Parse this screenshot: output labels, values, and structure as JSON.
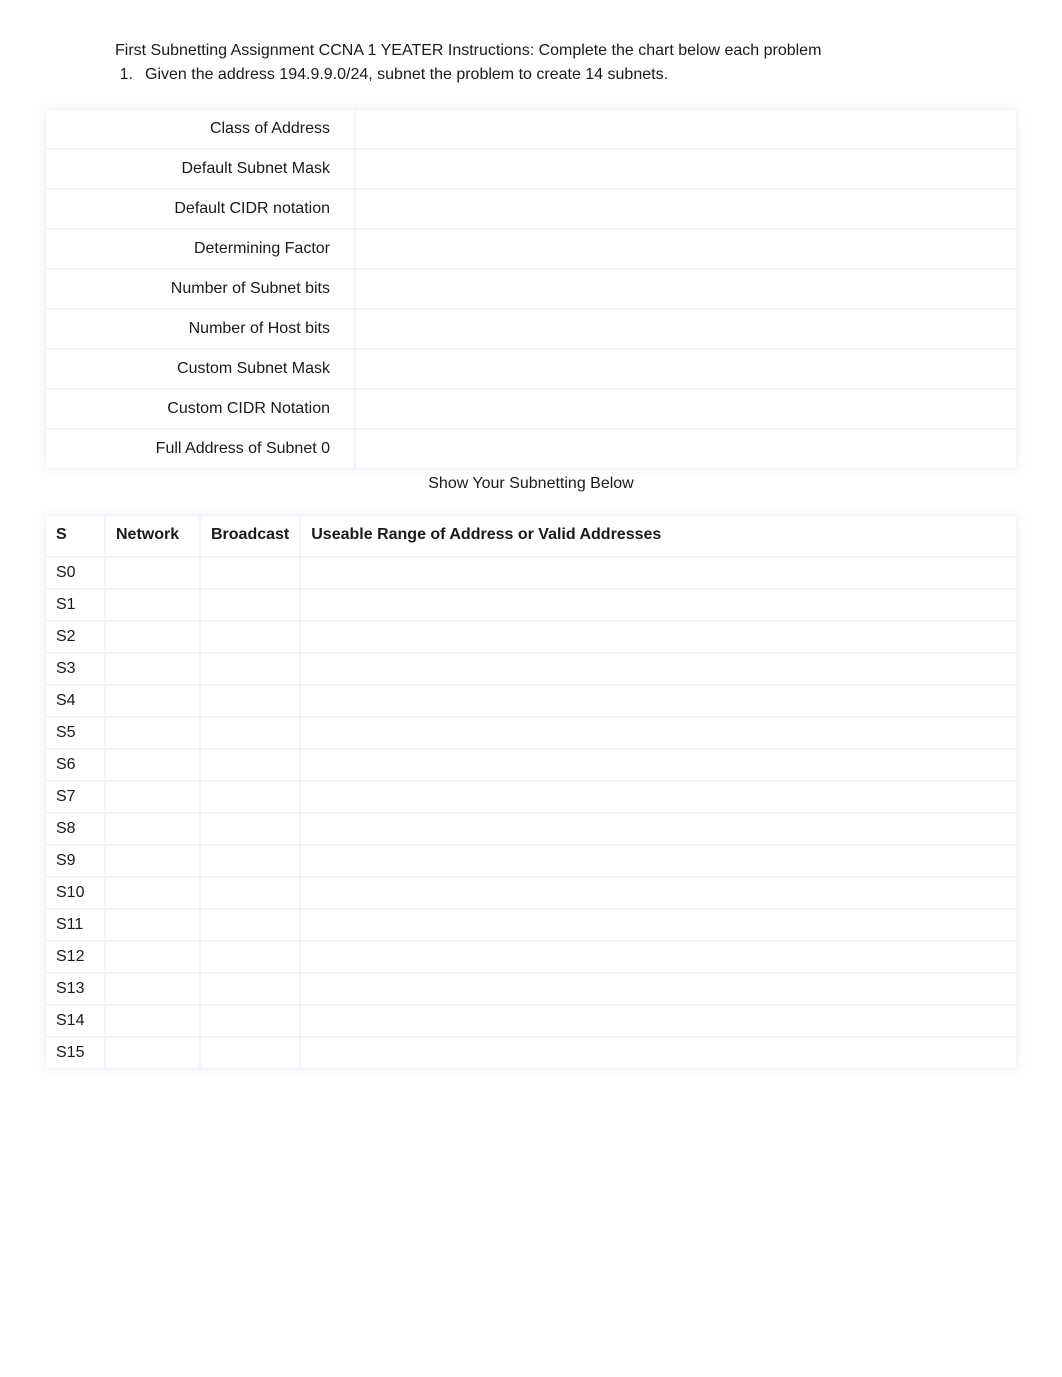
{
  "header": {
    "instructions": "First Subnetting Assignment CCNA 1   YEATER Instructions: Complete the chart below each problem",
    "problem_number": "1.",
    "problem_text": "Given the address 194.9.9.0/24, subnet the problem to create 14 subnets."
  },
  "info_rows": [
    {
      "label": "Class of Address",
      "value": ""
    },
    {
      "label": "Default Subnet Mask",
      "value": ""
    },
    {
      "label": "Default CIDR notation",
      "value": ""
    },
    {
      "label": "Determining Factor",
      "value": ""
    },
    {
      "label": "Number of Subnet bits",
      "value": ""
    },
    {
      "label": "Number of Host bits",
      "value": ""
    },
    {
      "label": "Custom Subnet Mask",
      "value": ""
    },
    {
      "label": "Custom CIDR Notation",
      "value": ""
    },
    {
      "label": "Full Address of Subnet 0",
      "value": ""
    }
  ],
  "subnetting_caption": "Show Your Subnetting Below",
  "subnet_headers": {
    "s": "S",
    "network": "Network",
    "broadcast": "Broadcast",
    "range": "Useable Range of Address or Valid Addresses"
  },
  "subnet_rows": [
    {
      "s": "S0",
      "network": "",
      "broadcast": "",
      "range": ""
    },
    {
      "s": "S1",
      "network": "",
      "broadcast": "",
      "range": ""
    },
    {
      "s": "S2",
      "network": "",
      "broadcast": "",
      "range": ""
    },
    {
      "s": "S3",
      "network": "",
      "broadcast": "",
      "range": ""
    },
    {
      "s": "S4",
      "network": "",
      "broadcast": "",
      "range": ""
    },
    {
      "s": "S5",
      "network": "",
      "broadcast": "",
      "range": ""
    },
    {
      "s": "S6",
      "network": "",
      "broadcast": "",
      "range": ""
    },
    {
      "s": "S7",
      "network": "",
      "broadcast": "",
      "range": ""
    },
    {
      "s": "S8",
      "network": "",
      "broadcast": "",
      "range": ""
    },
    {
      "s": "S9",
      "network": "",
      "broadcast": "",
      "range": ""
    },
    {
      "s": "S10",
      "network": "",
      "broadcast": "",
      "range": ""
    },
    {
      "s": "S11",
      "network": "",
      "broadcast": "",
      "range": ""
    },
    {
      "s": "S12",
      "network": "",
      "broadcast": "",
      "range": ""
    },
    {
      "s": "S13",
      "network": "",
      "broadcast": "",
      "range": ""
    },
    {
      "s": "S14",
      "network": "",
      "broadcast": "",
      "range": ""
    },
    {
      "s": "S15",
      "network": "",
      "broadcast": "",
      "range": ""
    }
  ]
}
